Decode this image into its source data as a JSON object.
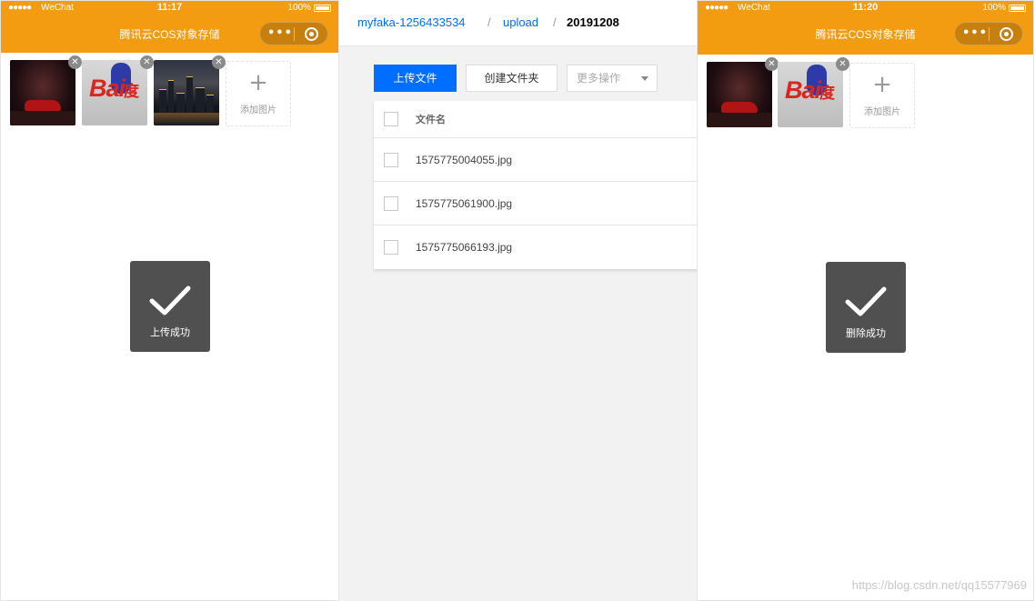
{
  "left_phone": {
    "status": {
      "signal": "●●●●●",
      "carrier": "WeChat",
      "time": "11:17",
      "battery": "100%"
    },
    "nav_title": "腾讯云COS对象存储",
    "capsule": {
      "more_icon": "more-dots-icon",
      "close_icon": "target-circle-icon"
    },
    "add_label": "添加图片",
    "toast": "上传成功"
  },
  "console": {
    "breadcrumb": [
      "myfaka-1256433534",
      "/",
      "upload",
      "/",
      "20191208"
    ],
    "buttons": {
      "upload": "上传文件",
      "create_folder": "创建文件夹",
      "more": "更多操作"
    },
    "table": {
      "header": "文件名",
      "files": [
        "1575775004055.jpg",
        "1575775061900.jpg",
        "1575775066193.jpg"
      ]
    },
    "colors": {
      "link": "#006eff",
      "primary": "#006eff"
    }
  },
  "right_phone": {
    "status": {
      "signal": "●●●●●",
      "carrier": "WeChat",
      "time": "11:20",
      "battery": "100%"
    },
    "nav_title": "腾讯云COS对象存储",
    "add_label": "添加图片",
    "toast": "删除成功"
  },
  "theme": {
    "nav_color": "#f39c12"
  },
  "watermark": "https://blog.csdn.net/qq15577969"
}
